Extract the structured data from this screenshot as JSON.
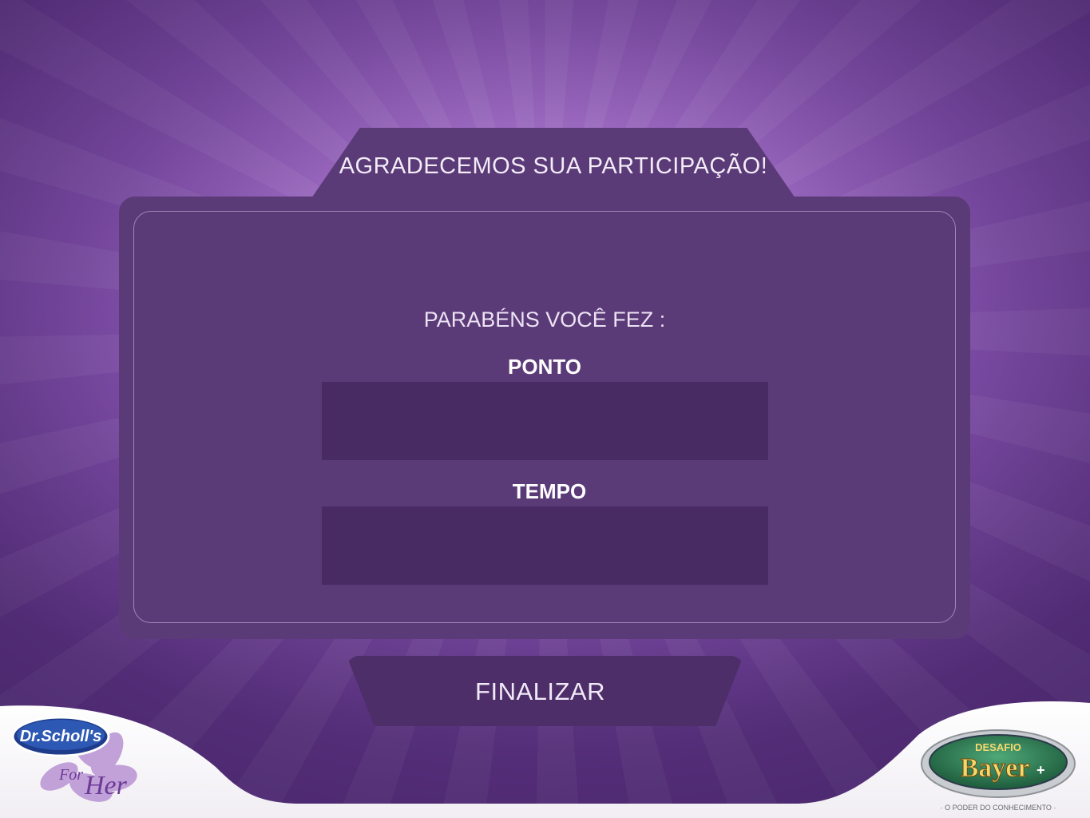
{
  "header": {
    "title": "AGRADECEMOS SUA PARTICIPAÇÃO!"
  },
  "result": {
    "congrats_text": "PARABÉNS VOCÊ FEZ :",
    "points_label": "PONTO",
    "points_value": "",
    "time_label": "TEMPO",
    "time_value": ""
  },
  "actions": {
    "finish_label": "FINALIZAR"
  },
  "brands": {
    "left_logo": {
      "name": "Dr.Scholl's",
      "sub": "For Her"
    },
    "right_logo": {
      "title_top": "DESAFIO",
      "title_main": "Bayer",
      "tagline": "O PODER DO CONHECIMENTO"
    }
  },
  "colors": {
    "background": "#9a68bf",
    "panel": "#5b3a78",
    "value_box": "#482b63",
    "button": "#4d2e69"
  }
}
